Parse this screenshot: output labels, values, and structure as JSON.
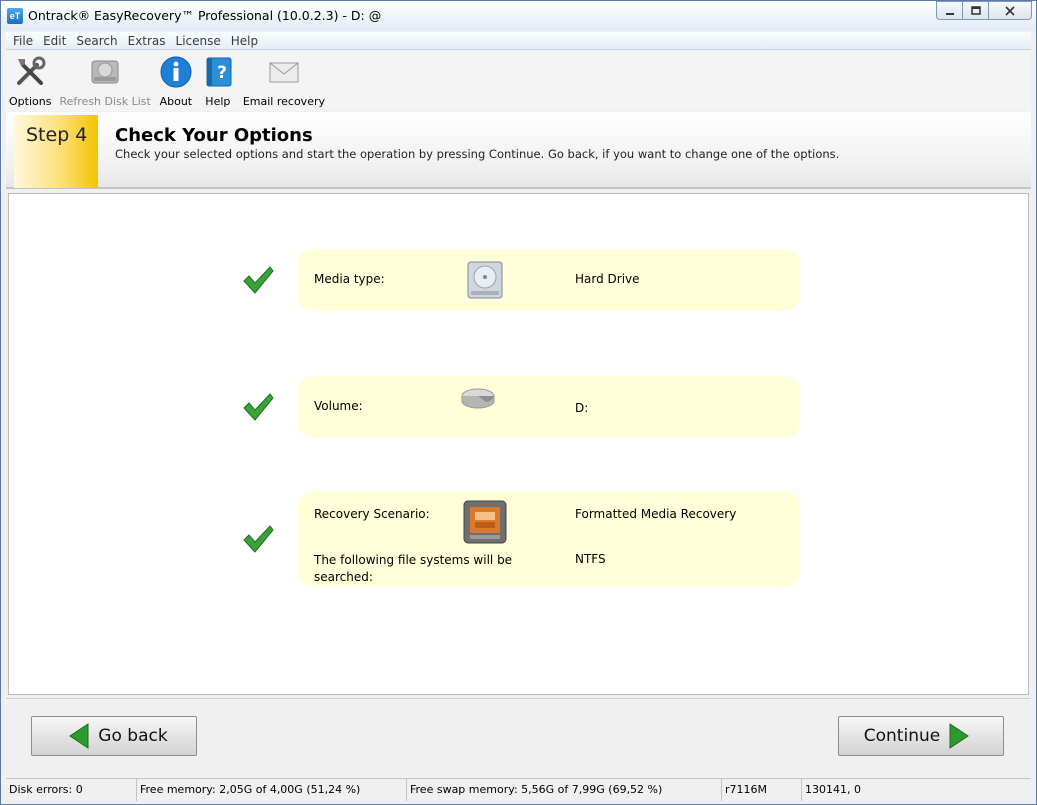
{
  "window": {
    "title": "Ontrack® EasyRecovery™ Professional (10.0.2.3) - D: @",
    "app_icon_text": "eT"
  },
  "menu": [
    "File",
    "Edit",
    "Search",
    "Extras",
    "License",
    "Help"
  ],
  "toolbar": {
    "options": "Options",
    "refresh": "Refresh Disk List",
    "about": "About",
    "help": "Help",
    "email": "Email recovery"
  },
  "step": {
    "number_label": "Step 4",
    "title": "Check Your Options",
    "description": "Check your selected options and start the operation by pressing Continue. Go back, if you want to change one of the options."
  },
  "options": [
    {
      "label": "Media type:",
      "value": "Hard Drive",
      "icon": "hard-drive-icon"
    },
    {
      "label": "Volume:",
      "value": "D:",
      "icon": "volume-icon"
    },
    {
      "label": "Recovery Scenario:",
      "value": "Formatted Media Recovery",
      "icon": "formatted-recovery-icon",
      "label2": "The following file systems will be searched:",
      "value2": "NTFS"
    }
  ],
  "nav": {
    "back": "Go back",
    "continue": "Continue"
  },
  "status": {
    "disk_errors": "Disk errors: 0",
    "free_memory": "Free memory: 2,05G of 4,00G (51,24 %)",
    "free_swap": "Free swap memory: 5,56G of 7,99G (69,52 %)",
    "build": "r7116M",
    "coords": "130141, 0"
  },
  "colors": {
    "check_green": "#3aa23a",
    "card_bg": "#ffffd9",
    "step_accent": "#f5c400"
  }
}
